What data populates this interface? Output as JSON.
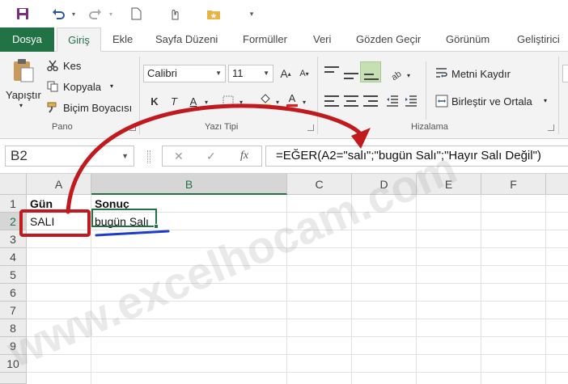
{
  "quick_access": {
    "icons": [
      "save-icon",
      "undo-icon",
      "redo-icon",
      "new-document-icon",
      "touch-mode-icon",
      "folder-star-icon",
      "customize-toolbar-icon"
    ]
  },
  "tabs": [
    "Dosya",
    "Giriş",
    "Ekle",
    "Sayfa Düzeni",
    "Formüller",
    "Veri",
    "Gözden Geçir",
    "Görünüm",
    "Geliştirici"
  ],
  "active_tab": "Giriş",
  "ribbon": {
    "clipboard": {
      "paste_label": "Yapıştır",
      "cut_label": "Kes",
      "copy_label": "Kopyala",
      "format_painter_label": "Biçim Boyacısı",
      "group_label": "Pano"
    },
    "font": {
      "font_name": "Calibri",
      "font_size": "11",
      "bold_glyph": "K",
      "italic_glyph": "T",
      "underline_glyph": "A",
      "grow_glyph": "A",
      "shrink_glyph": "A",
      "font_color_glyph": "A",
      "group_label": "Yazı Tipi"
    },
    "alignment": {
      "wrap_text_label": "Metni Kaydır",
      "merge_center_label": "Birleştir ve Ortala",
      "group_label": "Hizalama"
    }
  },
  "formula_bar": {
    "name_box": "B2",
    "cancel_glyph": "✕",
    "enter_glyph": "✓",
    "fx_glyph": "fx",
    "formula": "=EĞER(A2=\"salı\";\"bugün Salı\";\"Hayır Salı Değil\")"
  },
  "sheet": {
    "columns": [
      "A",
      "B",
      "C",
      "D",
      "E",
      "F"
    ],
    "rows": [
      "1",
      "2",
      "3",
      "4",
      "5",
      "6",
      "7",
      "8",
      "9",
      "10"
    ],
    "cells": {
      "A1": "Gün",
      "B1": "Sonuç",
      "A2": "SALI",
      "B2": "bugün Salı"
    },
    "selected_cell": "B2"
  },
  "annotation_colors": {
    "arrow": "#c0191e",
    "underline": "#1a3cc8",
    "excel_green": "#217346"
  },
  "watermark": "www.excelhocam.com"
}
